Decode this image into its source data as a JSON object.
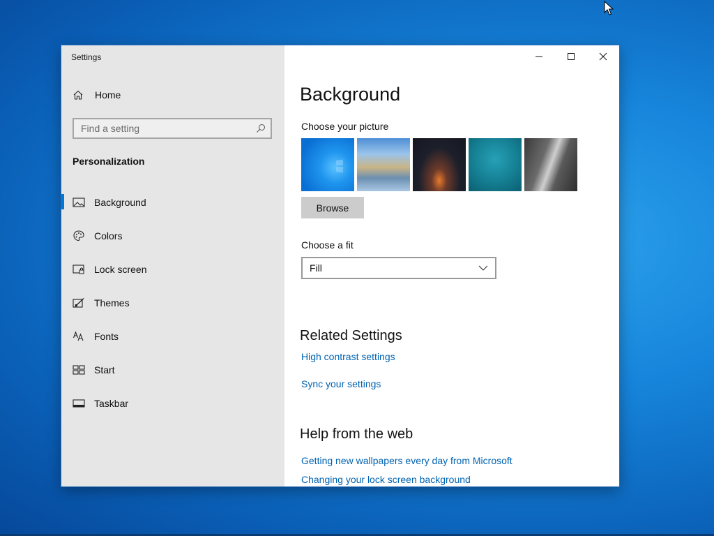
{
  "window": {
    "app_title": "Settings"
  },
  "sidebar": {
    "home_label": "Home",
    "search_placeholder": "Find a setting",
    "section_title": "Personalization",
    "items": [
      {
        "label": "Background",
        "icon": "picture-icon",
        "active": true
      },
      {
        "label": "Colors",
        "icon": "palette-icon",
        "active": false
      },
      {
        "label": "Lock screen",
        "icon": "lock-screen-icon",
        "active": false
      },
      {
        "label": "Themes",
        "icon": "themes-icon",
        "active": false
      },
      {
        "label": "Fonts",
        "icon": "fonts-icon",
        "active": false
      },
      {
        "label": "Start",
        "icon": "start-icon",
        "active": false
      },
      {
        "label": "Taskbar",
        "icon": "taskbar-icon",
        "active": false
      }
    ]
  },
  "main": {
    "title": "Background",
    "choose_picture_label": "Choose your picture",
    "browse_label": "Browse",
    "choose_fit_label": "Choose a fit",
    "fit_value": "Fill",
    "related_heading": "Related Settings",
    "related_links": [
      "High contrast settings",
      "Sync your settings"
    ],
    "help_heading": "Help from the web",
    "help_links": [
      "Getting new wallpapers every day from Microsoft",
      "Changing your lock screen background"
    ]
  },
  "colors": {
    "accent": "#0078d7",
    "link": "#0063b1",
    "sidebar_bg": "#e6e6e6"
  }
}
